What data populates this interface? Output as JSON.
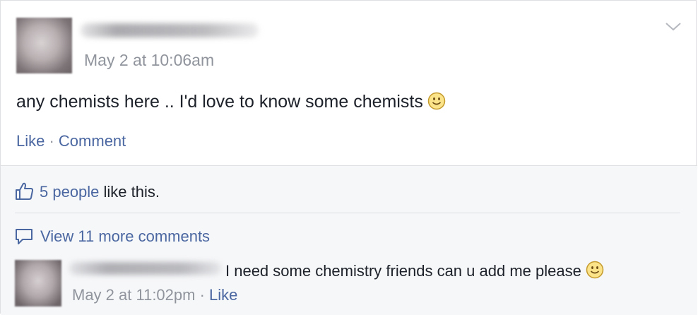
{
  "post": {
    "timestamp": "May 2 at 10:06am",
    "text": "any chemists here .. I'd love to know some chemists",
    "actions": {
      "like": "Like",
      "separator": " · ",
      "comment": "Comment"
    }
  },
  "feedback": {
    "likes_link": "5 people",
    "likes_suffix": " like this.",
    "more_comments": "View 11 more comments"
  },
  "comment": {
    "text": "I need some chemistry friends can u add me please",
    "timestamp": "May 2 at 11:02pm",
    "separator": " · ",
    "like": "Like"
  },
  "colors": {
    "link": "#4b67a1",
    "meta": "#90949c",
    "text": "#1d2129",
    "feedback_bg": "#f6f7f9"
  },
  "icons": [
    "chevron-down-icon",
    "smiley-icon",
    "thumbs-up-icon",
    "comment-bubble-icon"
  ]
}
